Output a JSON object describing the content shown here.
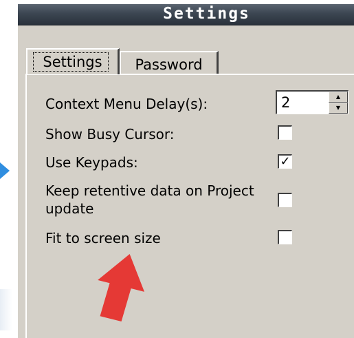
{
  "window": {
    "title": "Settings"
  },
  "tabs": [
    {
      "label": "Settings",
      "active": true
    },
    {
      "label": "Password",
      "active": false
    }
  ],
  "settings": {
    "context_menu_delay": {
      "label": "Context Menu Delay(s):",
      "value": "2"
    },
    "show_busy_cursor": {
      "label": "Show Busy Cursor:",
      "checked": false
    },
    "use_keypads": {
      "label": "Use Keypads:",
      "checked": true,
      "check_glyph": "✓"
    },
    "keep_retentive": {
      "label_line1": "Keep retentive data on Project",
      "label_line2": "update",
      "checked": false
    },
    "fit_to_screen": {
      "label": "Fit to screen size",
      "checked": false
    }
  },
  "icons": {
    "spin_up": "▲",
    "spin_down": "▼",
    "annotation_arrow_color": "#e53935",
    "left_arrow_color": "#2f8ee0"
  }
}
